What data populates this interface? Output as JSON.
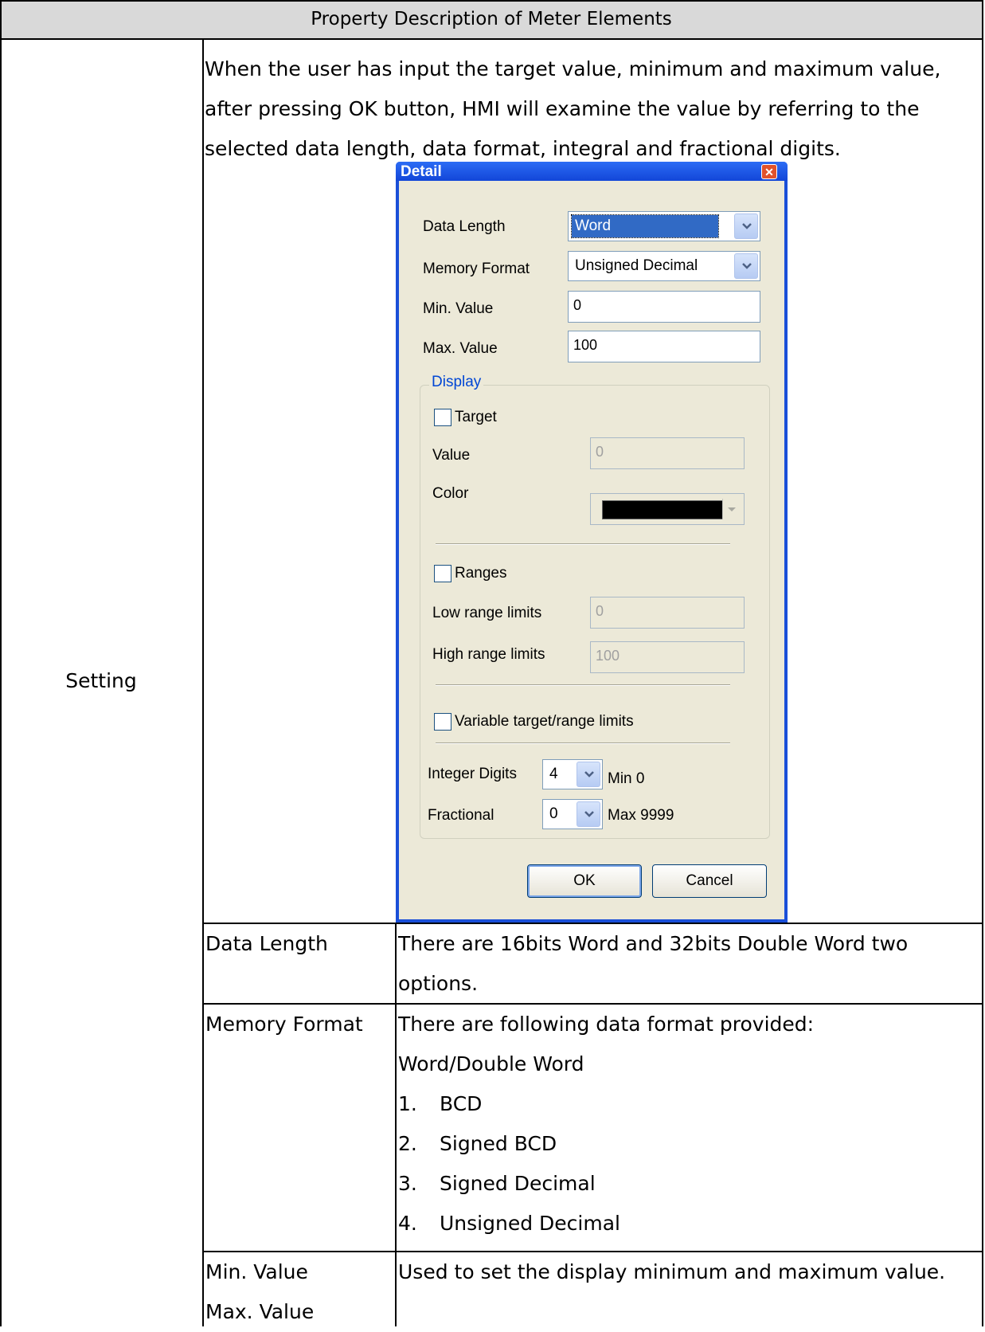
{
  "table": {
    "header": "Property Description of Meter Elements",
    "setting_label": "Setting",
    "intro_lines": [
      "When the user has input the target value, minimum and maximum value,",
      "after pressing OK button, HMI will examine the value by referring to the",
      "selected data length, data format, integral and fractional digits."
    ],
    "rows": {
      "data_length": {
        "name": "Data Length",
        "desc_lines": [
          "There are 16bits Word and 32bits Double Word two",
          "options."
        ]
      },
      "memory_format": {
        "name": "Memory Format",
        "desc_lines": [
          "There are following data format provided:",
          "Word/Double Word"
        ],
        "list": [
          {
            "num": "1.",
            "text": "BCD"
          },
          {
            "num": "2.",
            "text": "Signed BCD"
          },
          {
            "num": "3.",
            "text": "Signed Decimal"
          },
          {
            "num": "4.",
            "text": "Unsigned Decimal"
          }
        ]
      },
      "min_max": {
        "name_lines": [
          "Min. Value",
          "Max. Value"
        ],
        "desc": "Used to set the display minimum and maximum value."
      }
    }
  },
  "dialog": {
    "title": "Detail",
    "close_glyph": "✕",
    "data_length": {
      "label": "Data Length",
      "value": "Word"
    },
    "memory_format": {
      "label": "Memory Format",
      "value": "Unsigned Decimal"
    },
    "min_value": {
      "label": "Min. Value",
      "value": "0"
    },
    "max_value": {
      "label": "Max. Value",
      "value": "100"
    },
    "display_group": "Display",
    "target": {
      "label": "Target",
      "checked": false
    },
    "value": {
      "label": "Value",
      "value": "0"
    },
    "color": {
      "label": "Color",
      "value": "#000000"
    },
    "ranges": {
      "label": "Ranges",
      "checked": false
    },
    "low_range": {
      "label": "Low range limits",
      "value": "0"
    },
    "high_range": {
      "label": "High range limits",
      "value": "100"
    },
    "variable": {
      "label": "Variable target/range limits",
      "checked": false
    },
    "integer_digits": {
      "label": "Integer Digits",
      "value": "4",
      "hint": "Min 0"
    },
    "fractional": {
      "label": "Fractional",
      "value": "0",
      "hint": "Max 9999"
    },
    "ok": "OK",
    "cancel": "Cancel"
  }
}
